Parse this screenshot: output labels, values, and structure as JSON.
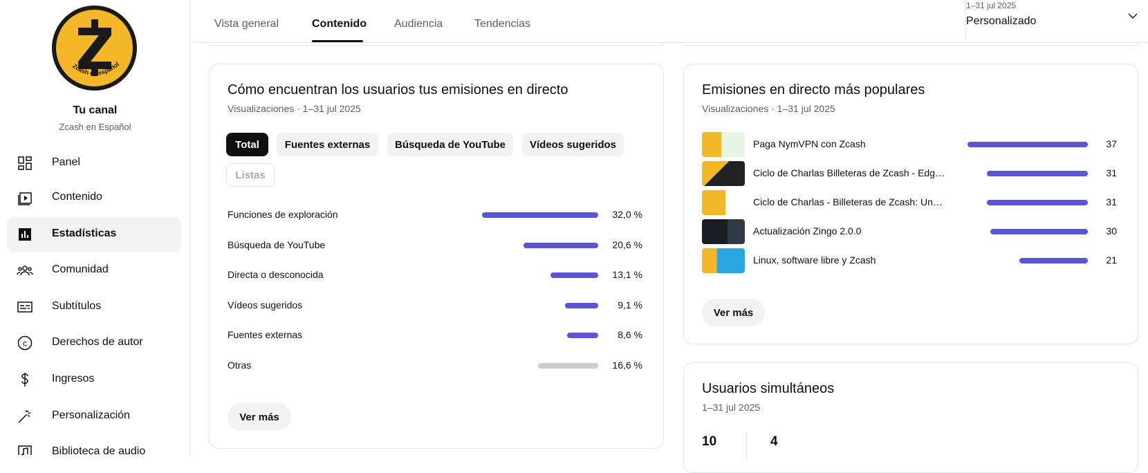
{
  "channel": {
    "title": "Tu canal",
    "subtitle": "Zcash en Español",
    "logo_text": "Zcash en español"
  },
  "nav": [
    {
      "label": "Panel",
      "icon": "dashboard-icon"
    },
    {
      "label": "Contenido",
      "icon": "content-icon"
    },
    {
      "label": "Estadísticas",
      "icon": "analytics-icon"
    },
    {
      "label": "Comunidad",
      "icon": "community-icon"
    },
    {
      "label": "Subtítulos",
      "icon": "subtitles-icon"
    },
    {
      "label": "Derechos de autor",
      "icon": "copyright-icon"
    },
    {
      "label": "Ingresos",
      "icon": "dollar-icon"
    },
    {
      "label": "Personalización",
      "icon": "magic-wand-icon"
    },
    {
      "label": "Biblioteca de audio",
      "icon": "audio-library-icon"
    }
  ],
  "tabs": [
    "Vista general",
    "Contenido",
    "Audiencia",
    "Tendencias"
  ],
  "date_range": {
    "range": "1–31 jul 2025",
    "label": "Personalizado"
  },
  "discovery": {
    "title": "Cómo encuentran los usuarios tus emisiones en directo",
    "subtitle": "Visualizaciones · 1–31 jul 2025",
    "chips": [
      "Total",
      "Fuentes externas",
      "Búsqueda de YouTube",
      "Vídeos sugeridos",
      "Listas"
    ],
    "rows": [
      {
        "label": "Funciones de exploración",
        "value": "32,0 %",
        "share": 0.32
      },
      {
        "label": "Búsqueda de YouTube",
        "value": "20,6 %",
        "share": 0.206
      },
      {
        "label": "Directa o desconocida",
        "value": "13,1 %",
        "share": 0.131
      },
      {
        "label": "Vídeos sugeridos",
        "value": "9,1 %",
        "share": 0.091
      },
      {
        "label": "Fuentes externas",
        "value": "8,6 %",
        "share": 0.086
      },
      {
        "label": "Otras",
        "value": "16,6 %",
        "share": 0.166
      }
    ],
    "more_label": "Ver más"
  },
  "popular": {
    "title": "Emisiones en directo más populares",
    "subtitle": "Visualizaciones · 1–31 jul 2025",
    "items": [
      {
        "title": "Paga NymVPN con Zcash",
        "value": "37",
        "count": 37
      },
      {
        "title": "Ciclo de Charlas Billeteras de Zcash - Edge ...",
        "value": "31",
        "count": 31
      },
      {
        "title": "Ciclo de Charlas - Billeteras de Zcash: Unst...",
        "value": "31",
        "count": 31
      },
      {
        "title": "Actualización Zingo 2.0.0",
        "value": "30",
        "count": 30
      },
      {
        "title": "Linux, software libre y Zcash",
        "value": "21",
        "count": 21
      }
    ],
    "more_label": "Ver más"
  },
  "concurrent": {
    "title": "Usuarios simultáneos",
    "subtitle": "1–31 jul 2025",
    "values": [
      "10",
      "4"
    ]
  },
  "colors": {
    "accent_bar": "#5b55d6",
    "other_bar": "#cccccc",
    "logo_yellow": "#f4b728"
  }
}
